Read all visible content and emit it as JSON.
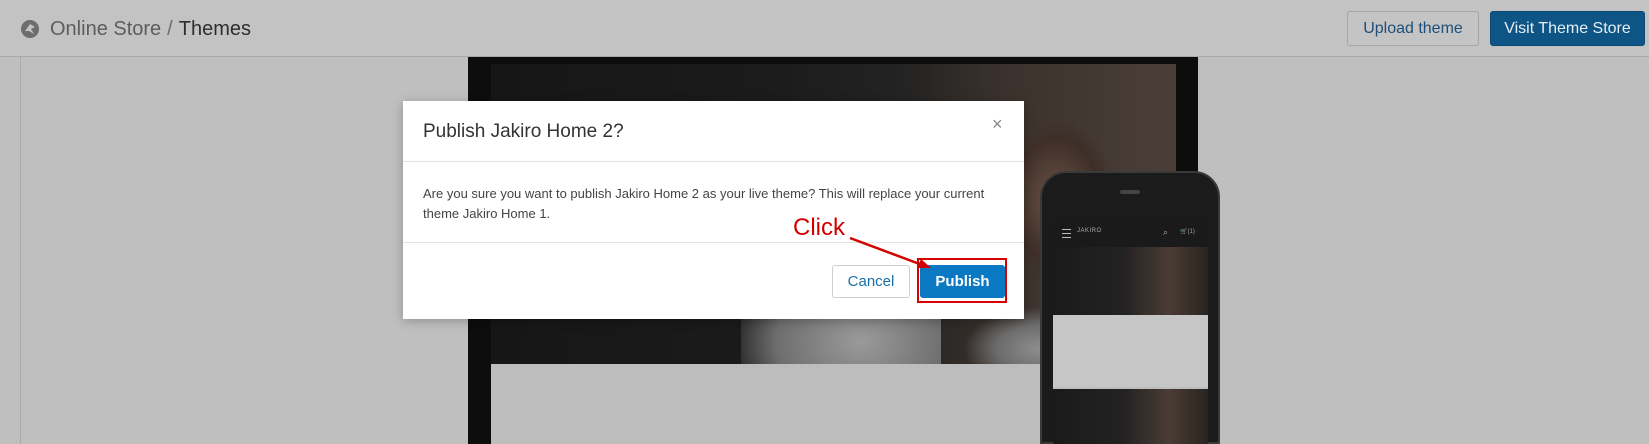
{
  "header": {
    "breadcrumb_parent": "Online Store",
    "breadcrumb_separator": "/",
    "breadcrumb_current": "Themes",
    "upload_label": "Upload theme",
    "visit_label": "Visit Theme Store"
  },
  "preview": {
    "phone_brand": "JAKIRO",
    "phone_cart": "(1)"
  },
  "modal": {
    "title": "Publish Jakiro Home 2?",
    "close_glyph": "×",
    "body": "Are you sure you want to publish Jakiro Home 2 as your live theme? This will replace your current theme Jakiro Home 1.",
    "cancel_label": "Cancel",
    "publish_label": "Publish"
  },
  "annotation": {
    "label": "Click",
    "color": "#d20000"
  },
  "icons": {
    "store": "online-store-icon",
    "close": "close-icon",
    "menu": "hamburger-icon",
    "search": "search-icon",
    "cart": "cart-icon"
  },
  "colors": {
    "primary_button": "#0a78c3",
    "visit_button": "#0e5585",
    "overlay": "#bfbfbf"
  }
}
